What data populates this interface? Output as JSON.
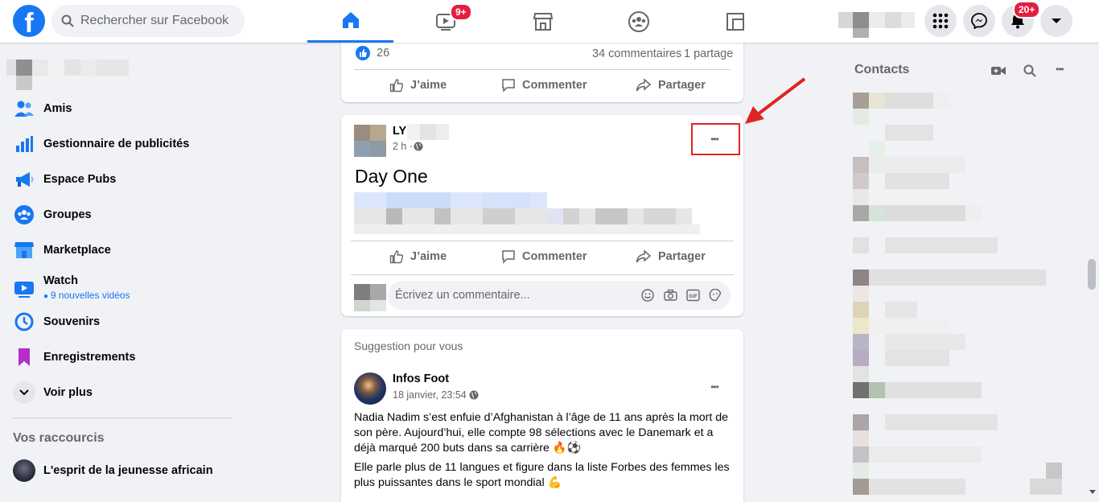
{
  "header": {
    "logo": "f",
    "search_placeholder": "Rechercher sur Facebook",
    "badges": {
      "watch": "9+",
      "notifications": "20+"
    },
    "icons": [
      "home-icon",
      "watch-icon",
      "marketplace-icon",
      "groups-icon",
      "gaming-icon",
      "menu-grid-icon",
      "messenger-icon",
      "bell-icon",
      "caret-down-icon"
    ]
  },
  "left_nav": {
    "items": [
      {
        "label": "Amis",
        "icon": "friends-icon"
      },
      {
        "label": "Gestionnaire de publicités",
        "icon": "ads-manager-icon"
      },
      {
        "label": "Espace Pubs",
        "icon": "megaphone-icon"
      },
      {
        "label": "Groupes",
        "icon": "groups-icon"
      },
      {
        "label": "Marketplace",
        "icon": "marketplace-icon"
      },
      {
        "label": "Watch",
        "icon": "watch-icon",
        "sub": "9 nouvelles vidéos"
      },
      {
        "label": "Souvenirs",
        "icon": "clock-icon"
      },
      {
        "label": "Enregistrements",
        "icon": "bookmark-icon"
      },
      {
        "label": "Voir plus",
        "icon": "chevron-down-icon"
      }
    ],
    "shortcuts_title": "Vos raccourcis",
    "shortcuts": [
      {
        "label": "L'esprit de la jeunesse africain"
      }
    ]
  },
  "post1": {
    "likes": "26",
    "comments": "34 commentaires",
    "shares": "1 partage",
    "like_label": "J’aime",
    "comment_label": "Commenter",
    "share_label": "Partager"
  },
  "post2": {
    "author": "LY",
    "time": "2 h ·",
    "title": "Day One",
    "like_label": "J’aime",
    "comment_label": "Commenter",
    "share_label": "Partager",
    "comment_placeholder": "Écrivez un commentaire...",
    "more": "•••"
  },
  "post3": {
    "section": "Suggestion pour vous",
    "author": "Infos Foot",
    "date": "18 janvier, 23:54 ·",
    "more": "•••",
    "p1": "Nadia Nadim s’est enfuie d’Afghanistan à l’âge de 11 ans après la mort de son père. Aujourd’hui, elle compte 98 sélections avec le Danemark et a déjà marqué 200 buts dans sa carrière 🔥⚽",
    "p2": "Elle parle plus de 11 langues et figure dans la liste Forbes des femmes les plus puissantes dans le sport mondial 💪"
  },
  "contacts": {
    "title": "Contacts"
  },
  "colors": {
    "brand": "#1877f2",
    "badge": "#e41e3f",
    "annotation": "#e02424"
  }
}
